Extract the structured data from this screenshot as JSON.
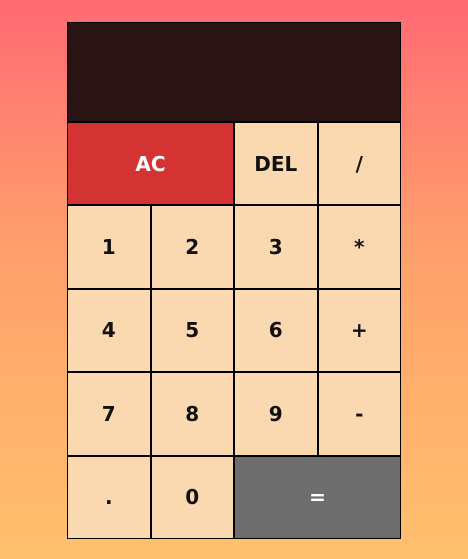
{
  "display": {
    "value": ""
  },
  "keys": {
    "ac": "AC",
    "del": "DEL",
    "divide": "/",
    "one": "1",
    "two": "2",
    "three": "3",
    "multiply": "*",
    "four": "4",
    "five": "5",
    "six": "6",
    "add": "+",
    "seven": "7",
    "eight": "8",
    "nine": "9",
    "subtract": "-",
    "decimal": ".",
    "zero": "0",
    "equals": "="
  },
  "colors": {
    "display_background": "#2a1313",
    "key_background": "#fad8b0",
    "clear_background": "#d33333",
    "equals_background": "#6e6e6e",
    "page_gradient_top": "#ff6a73",
    "page_gradient_bottom": "#ffc16d"
  }
}
